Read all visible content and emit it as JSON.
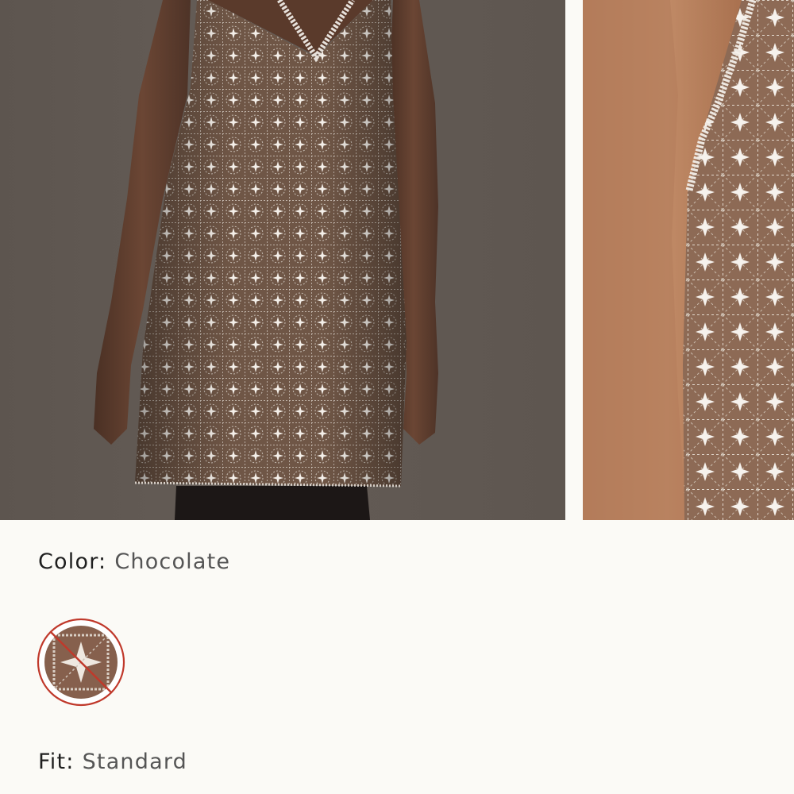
{
  "gallery": {
    "images": [
      {
        "name": "dress-back-view",
        "kind": "photo"
      },
      {
        "name": "dress-side-detail",
        "kind": "photo"
      }
    ]
  },
  "product": {
    "color": {
      "label": "Color:",
      "value": "Chocolate",
      "swatches": [
        {
          "name": "chocolate",
          "selected": true,
          "available": false
        }
      ]
    },
    "fit": {
      "label": "Fit:",
      "value": "Standard"
    }
  },
  "colors": {
    "background": "#fbfaf6",
    "text_primary": "#1f1f1f",
    "text_secondary": "#555555",
    "unavailable_slash": "#c0392b"
  }
}
